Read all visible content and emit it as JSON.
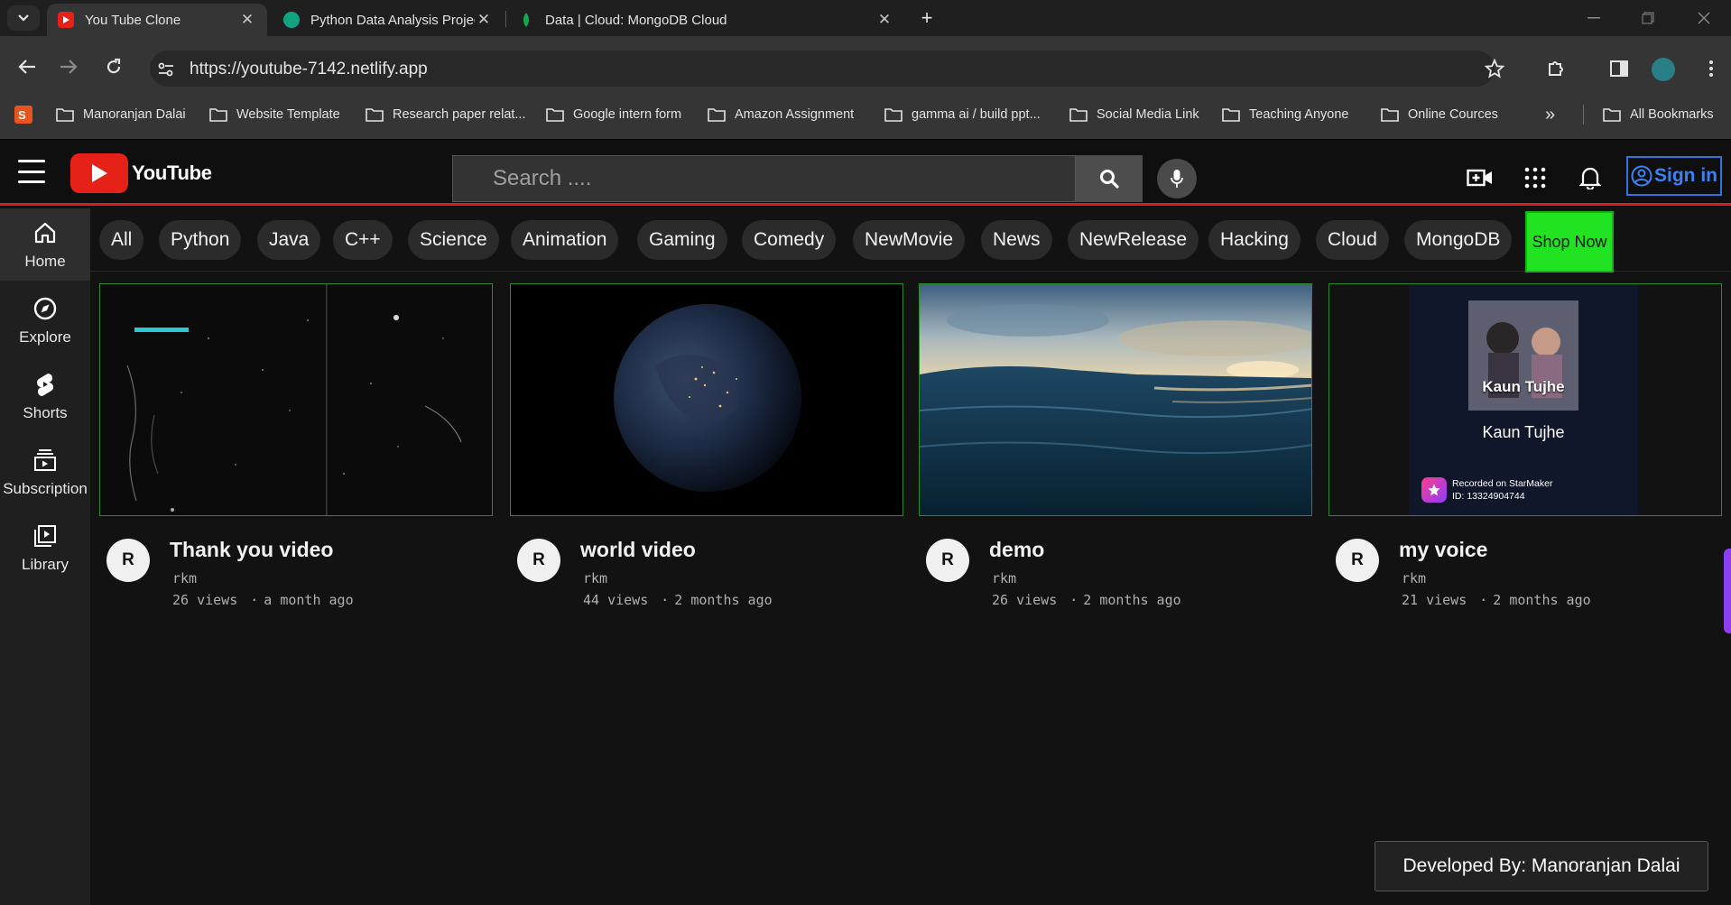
{
  "browser": {
    "tabs": [
      {
        "label": "You Tube Clone",
        "active": true,
        "favicon_color": "#e62117"
      },
      {
        "label": "Python Data Analysis Project",
        "active": false,
        "favicon_color": "#10a37f"
      },
      {
        "label": "Data | Cloud: MongoDB Cloud",
        "active": false,
        "favicon_color": "#13aa52"
      }
    ],
    "close_glyph": "✕",
    "new_tab_glyph": "+",
    "url": "https://youtube-7142.netlify.app",
    "bookmarks": [
      "Manoranjan Dalai",
      "Website Template",
      "Research paper relat...",
      "Google intern form",
      "Amazon Assignment",
      "gamma ai / build ppt...",
      "Social Media Link",
      "Teaching  Anyone",
      "Online Cources"
    ],
    "more_bookmarks_glyph": "»",
    "all_bookmarks": "All Bookmarks"
  },
  "header": {
    "logo_text": "YouTube",
    "search_placeholder": "Search ....",
    "sign_in": "Sign in",
    "accent": "#d32020",
    "sign_in_color": "#2f73e0"
  },
  "sidebar": {
    "items": [
      {
        "label": "Home",
        "icon": "home-icon",
        "active": true
      },
      {
        "label": "Explore",
        "icon": "compass-icon",
        "active": false
      },
      {
        "label": "Shorts",
        "icon": "shorts-icon",
        "active": false
      },
      {
        "label": "Subscription",
        "icon": "subscription-icon",
        "active": false
      },
      {
        "label": "Library",
        "icon": "library-icon",
        "active": false
      }
    ]
  },
  "chips": [
    "All",
    "Python",
    "Java",
    "C++",
    "Science",
    "Animation",
    "Gaming",
    "Comedy",
    "NewMovie",
    "News",
    "NewRelease",
    "Hacking",
    "Cloud",
    "MongoDB"
  ],
  "shop_button": "Shop Now",
  "shop_color": "#22e322",
  "videos": [
    {
      "title": "Thank you video",
      "channel": "rkm",
      "avatar": "R",
      "views": "26 views",
      "age": "a month ago"
    },
    {
      "title": "world video",
      "channel": "rkm",
      "avatar": "R",
      "views": "44 views",
      "age": "2 months ago"
    },
    {
      "title": "demo",
      "channel": "rkm",
      "avatar": "R",
      "views": "26 views",
      "age": "2 months ago"
    },
    {
      "title": "my voice",
      "channel": "rkm",
      "avatar": "R",
      "views": "21 views",
      "age": "2 months ago"
    }
  ],
  "thumbnail_texts": {
    "song_title": "Kaun Tujhe",
    "song_caption": "Kaun Tujhe",
    "recorded_on": "Recorded on StarMaker",
    "recording_id": "ID: 13324904744"
  },
  "meta_dot": "·",
  "footer": "Developed By: Manoranjan Dalai"
}
